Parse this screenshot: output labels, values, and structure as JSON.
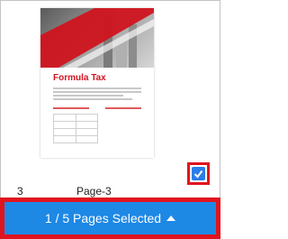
{
  "thumbnail": {
    "title": "Formula Tax",
    "colors": {
      "accent": "#d0141f"
    }
  },
  "checkbox": {
    "checked": true,
    "icon": "checkmark-icon"
  },
  "page": {
    "number": "3",
    "label": "Page-3"
  },
  "footer": {
    "label": "1 / 5 Pages Selected",
    "icon": "caret-up-icon",
    "colors": {
      "button": "#1e88e5",
      "highlight_border": "#e0141e"
    }
  }
}
